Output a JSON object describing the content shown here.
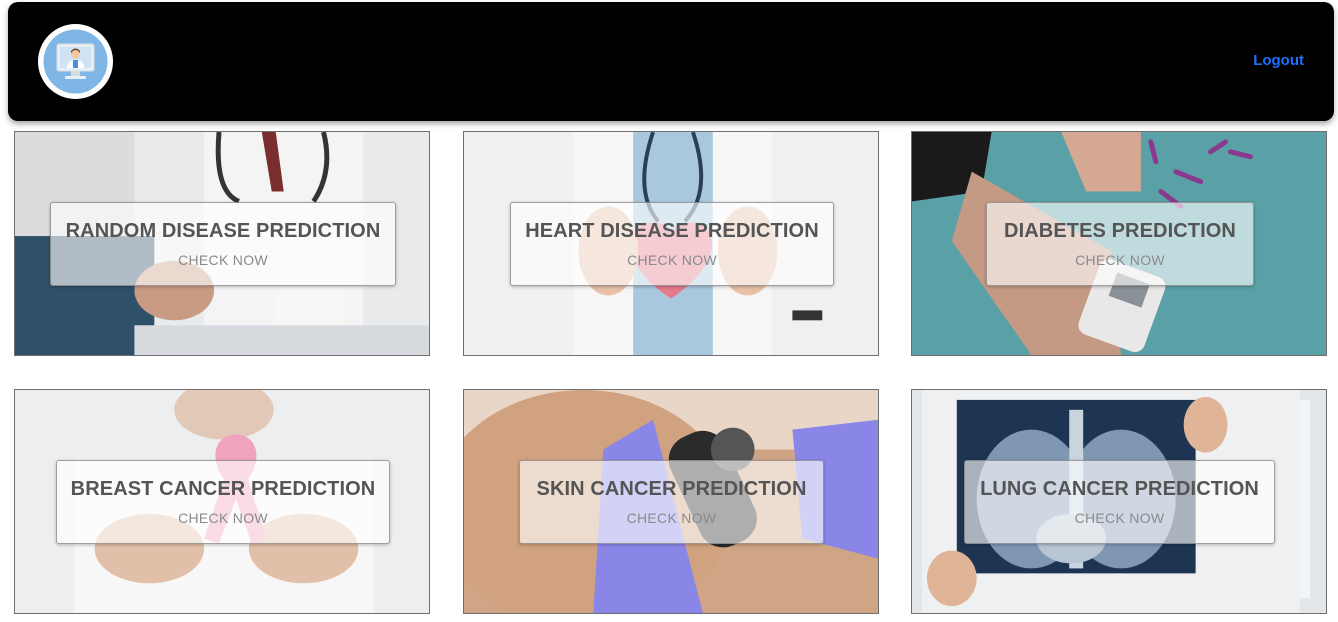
{
  "navbar": {
    "logo_icon": "doctor-monitor-icon",
    "logout_label": "Logout"
  },
  "cards": [
    {
      "title": "RANDOM DISEASE PREDICTION",
      "cta": "CHECK NOW"
    },
    {
      "title": "HEART DISEASE PREDICTION",
      "cta": "CHECK NOW"
    },
    {
      "title": "DIABETES PREDICTION",
      "cta": "CHECK NOW"
    },
    {
      "title": "BREAST CANCER PREDICTION",
      "cta": "CHECK NOW"
    },
    {
      "title": "SKIN CANCER PREDICTION",
      "cta": "CHECK NOW"
    },
    {
      "title": "LUNG CANCER PREDICTION",
      "cta": "CHECK NOW"
    }
  ],
  "colors": {
    "navbar_bg": "#000000",
    "logout": "#1f6fff",
    "logo_ring": "#7fb6e6"
  }
}
